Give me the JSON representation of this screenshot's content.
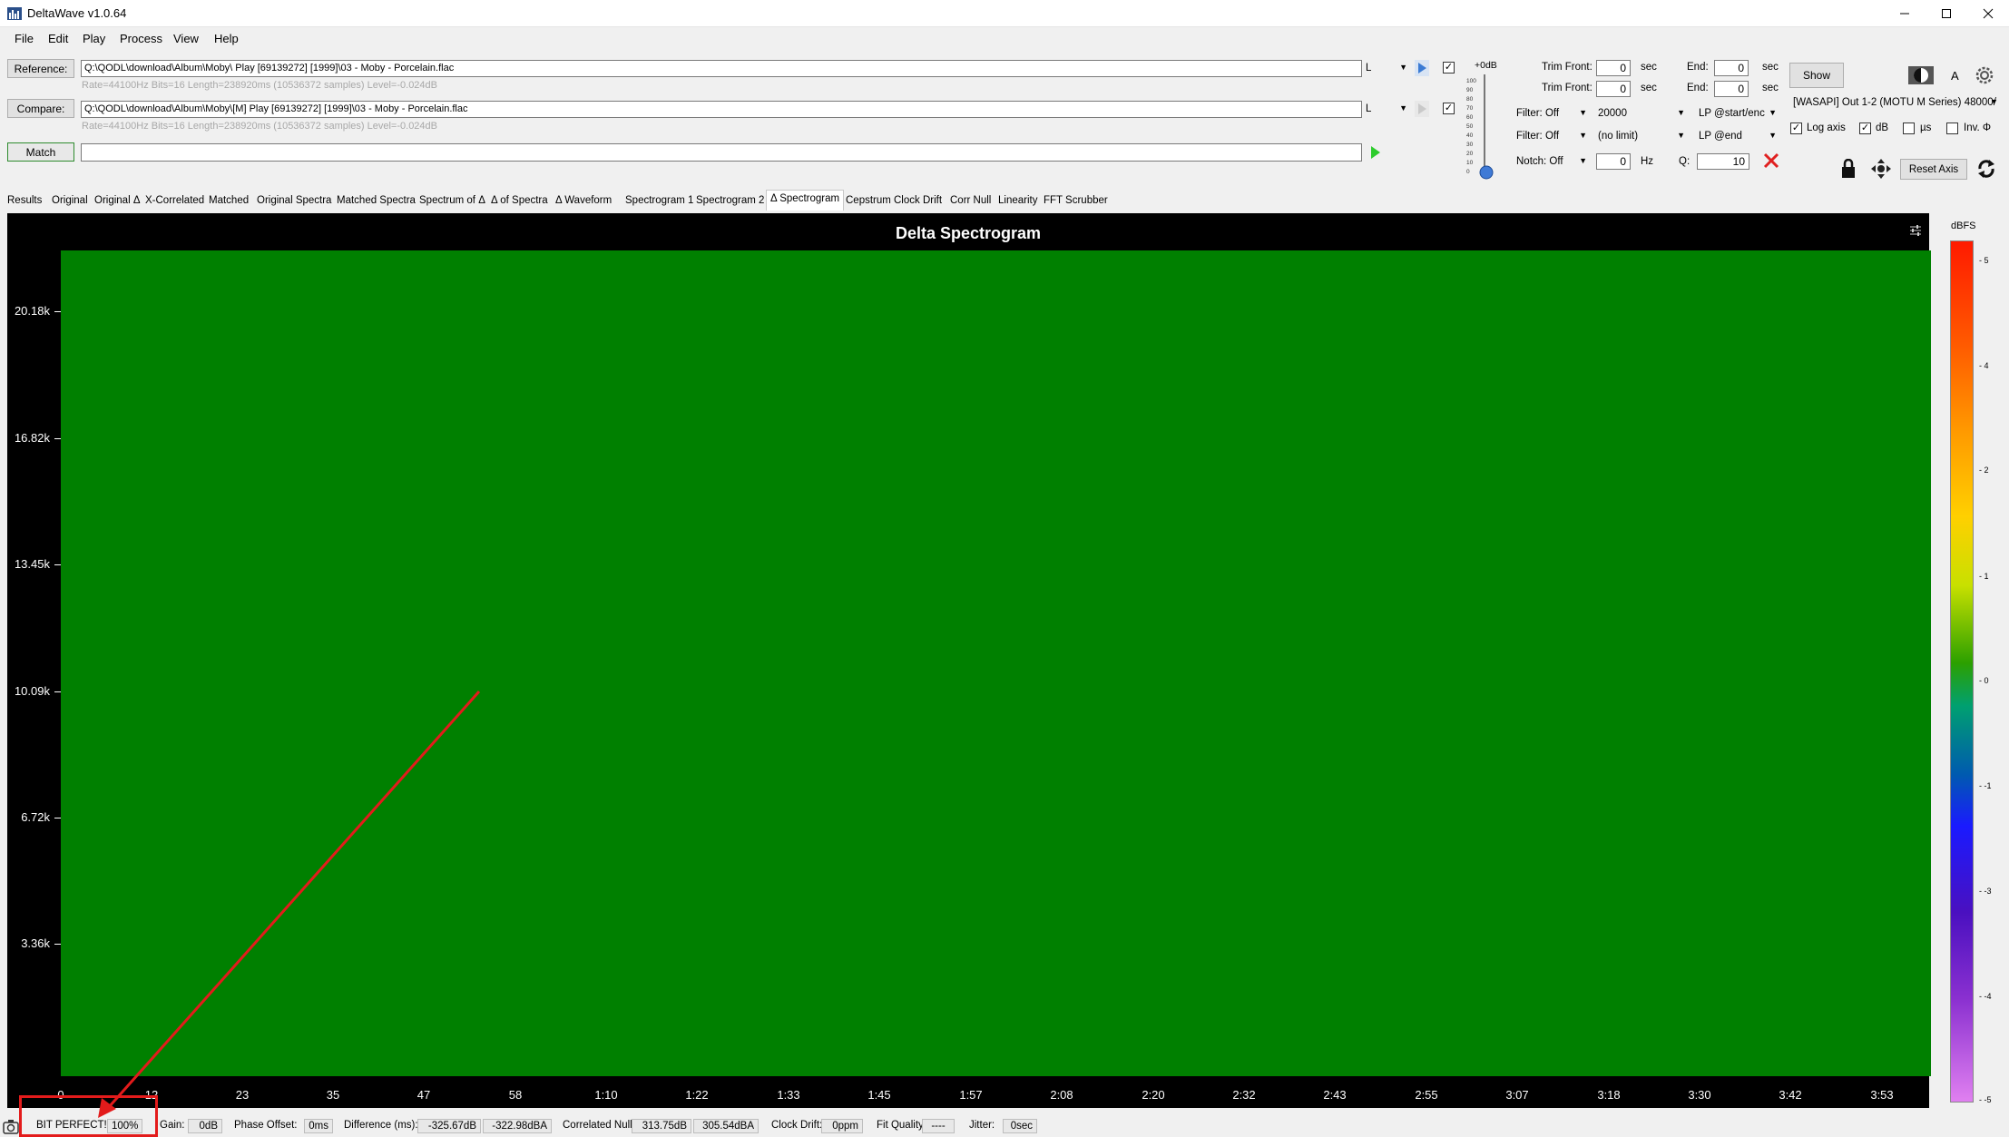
{
  "window": {
    "title": "DeltaWave v1.0.64"
  },
  "menu": [
    "File",
    "Edit",
    "Play",
    "Process",
    "View",
    "Help"
  ],
  "reference": {
    "button": "Reference:",
    "path": "Q:\\QODL\\download\\Album\\Moby\\ Play [69139272] [1999]\\03 - Moby - Porcelain.flac",
    "info": "Rate=44100Hz Bits=16 Length=238920ms (10536372 samples) Level=-0.024dB",
    "channel": "L"
  },
  "compare": {
    "button": "Compare:",
    "path": "Q:\\QODL\\download\\Album\\Moby\\[M] Play [69139272] [1999]\\03 - Moby - Porcelain.flac",
    "info": "Rate=44100Hz Bits=16 Length=238920ms (10536372 samples) Level=-0.024dB",
    "channel": "L"
  },
  "match": {
    "button": "Match",
    "progress": ""
  },
  "level": {
    "label": "+0dB",
    "ticks": [
      "100",
      "90",
      "80",
      "70",
      "60",
      "50",
      "40",
      "30",
      "20",
      "10",
      "0"
    ]
  },
  "trim": {
    "front_label": "Trim Front:",
    "front1": "0",
    "front2": "0",
    "sec": "sec",
    "end_label": "End:",
    "end1": "0",
    "end2": "0"
  },
  "filters": {
    "filter1": "Filter: Off",
    "freq1": "20000",
    "lp1": "LP @start/enc",
    "filter2": "Filter: Off",
    "freq2": "(no limit)",
    "lp2": "LP @end",
    "notch": "Notch: Off",
    "notch_val": "0",
    "hz": "Hz",
    "q_label": "Q:",
    "q_val": "10"
  },
  "right_panel": {
    "show_button": "Show",
    "a_label": "A",
    "output": "[WASAPI] Out 1-2 (MOTU M Series) 48000/",
    "log_axis": "Log axis",
    "db": "dB",
    "us": "µs",
    "inv": "Inv. Φ",
    "reset_axis": "Reset Axis"
  },
  "tabs": [
    "Results",
    "Original",
    "Original Δ",
    "X-Correlated",
    "Matched",
    "Original Spectra",
    "Matched Spectra",
    "Spectrum of Δ",
    "Δ of Spectra",
    "Δ Waveform",
    "Spectrogram 1",
    "Spectrogram 2",
    "Δ Spectrogram",
    "Cepstrum",
    "Clock Drift",
    "Corr Null",
    "Linearity",
    "FFT Scrubber"
  ],
  "active_tab": "Δ Spectrogram",
  "chart_data": {
    "type": "heatmap",
    "title": "Delta Spectrogram",
    "y_ticks": [
      "20.18k",
      "16.82k",
      "13.45k",
      "10.09k",
      "6.72k",
      "3.36k"
    ],
    "x_ticks": [
      "0",
      "12",
      "23",
      "35",
      "47",
      "58",
      "1:10",
      "1:22",
      "1:33",
      "1:45",
      "1:57",
      "2:08",
      "2:20",
      "2:32",
      "2:43",
      "2:55",
      "3:07",
      "3:18",
      "3:30",
      "3:42",
      "3:53"
    ],
    "colorbar": {
      "label": "dBFS",
      "ticks": [
        "5",
        "4",
        "2",
        "1",
        "0",
        "-1",
        "-3",
        "-4",
        "-5"
      ]
    },
    "fill_color": "#008000"
  },
  "status": {
    "bit_perfect": "BIT PERFECT!",
    "percent": "100%",
    "gain_label": "Gain:",
    "gain": "0dB",
    "phase_label": "Phase Offset:",
    "phase": "0ms",
    "diff_label": "Difference (ms):",
    "diff1": "-325.67dB",
    "diff2": "-322.98dBA",
    "corr_label": "Correlated Null:",
    "corr1": "313.75dB",
    "corr2": "305.54dBA",
    "clock_label": "Clock Drift:",
    "clock": "0ppm",
    "fit_label": "Fit Quality:",
    "fit": "----",
    "jitter_label": "Jitter:",
    "jitter": "0sec"
  },
  "annotation_color": "#e31b1b"
}
